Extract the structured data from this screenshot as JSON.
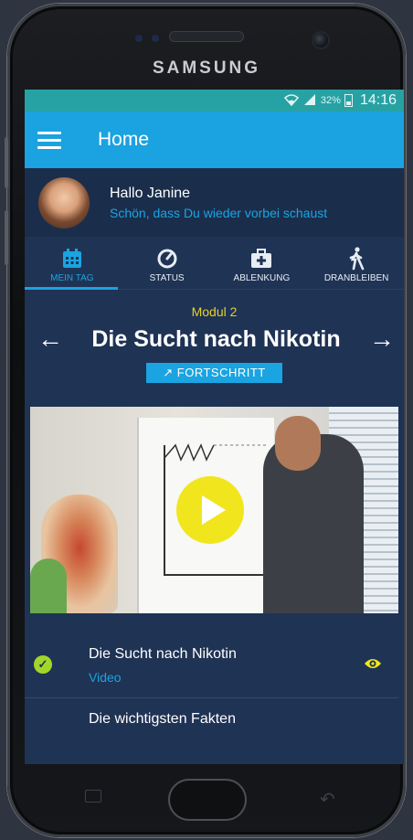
{
  "device": {
    "brand": "SAMSUNG"
  },
  "status_bar": {
    "battery": "32%",
    "time": "14:16"
  },
  "app_bar": {
    "title": "Home"
  },
  "profile": {
    "greeting": "Hallo Janine",
    "subtitle": "Schön, dass Du wieder vorbei schaust"
  },
  "tabs": [
    {
      "label": "MEIN TAG",
      "icon": "calendar-icon",
      "active": true
    },
    {
      "label": "STATUS",
      "icon": "gauge-icon",
      "active": false
    },
    {
      "label": "ABLENKUNG",
      "icon": "first-aid-kit-icon",
      "active": false
    },
    {
      "label": "DRANBLEIBEN",
      "icon": "walking-person-icon",
      "active": false
    }
  ],
  "module": {
    "label": "Modul 2",
    "title": "Die Sucht nach Nikotin",
    "progress_button": "FORTSCHRITT"
  },
  "video": {
    "thumbnail": "presenter-at-flipchart",
    "play_icon": "play-icon"
  },
  "lesson_items": [
    {
      "title": "Die Sucht nach Nikotin",
      "type": "Video",
      "completed": true,
      "action_icon": "eye-icon"
    },
    {
      "title": "Die wichtigsten Fakten"
    }
  ],
  "colors": {
    "accent": "#1aa4e2",
    "module_label": "#e6d12a",
    "play_button": "#f1e61e",
    "check": "#a3d62a",
    "status_bar": "#27a2a4",
    "background": "#1f3354"
  }
}
